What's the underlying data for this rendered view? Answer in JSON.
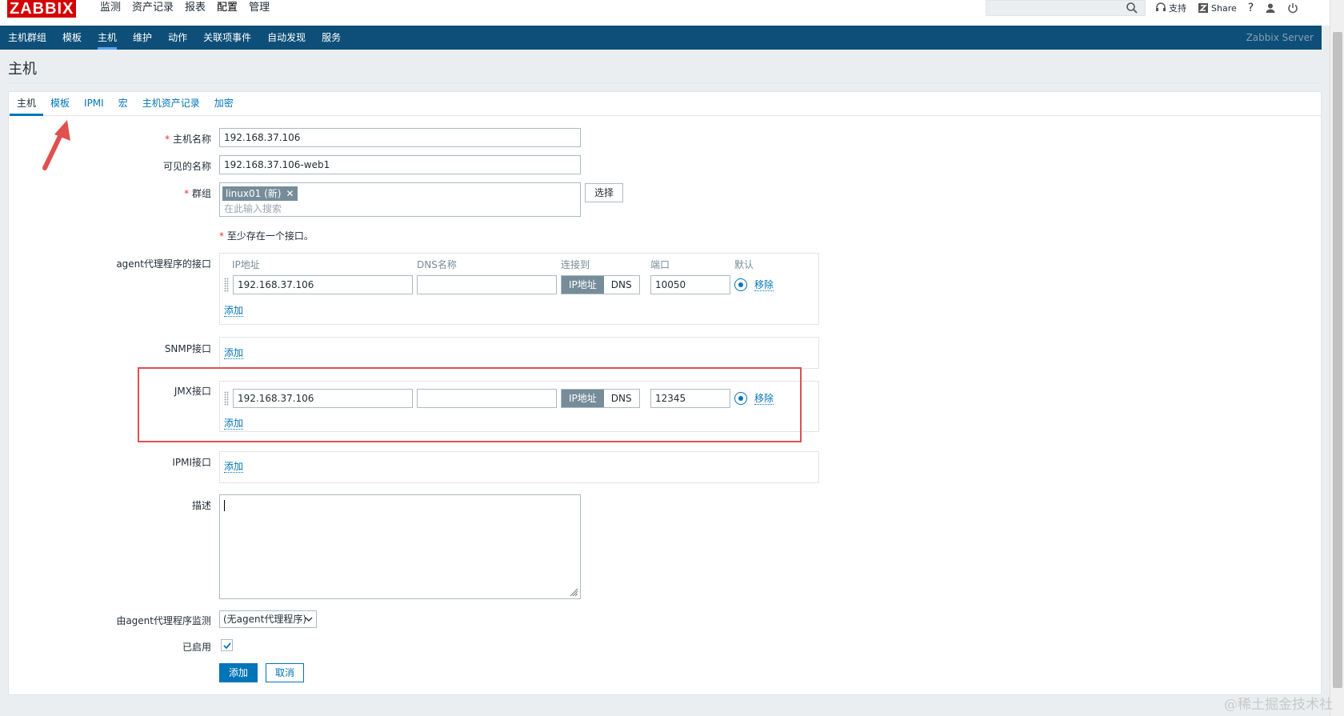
{
  "topbar": {
    "logo": "ZABBIX",
    "menu": [
      "监测",
      "资产记录",
      "报表",
      "配置",
      "管理"
    ],
    "support": "支持",
    "share": "Share",
    "help": "?"
  },
  "subnav": {
    "items": [
      "主机群组",
      "模板",
      "主机",
      "维护",
      "动作",
      "关联项事件",
      "自动发现",
      "服务"
    ],
    "server": "Zabbix Server"
  },
  "page_title": "主机",
  "tabs": [
    "主机",
    "模板",
    "IPMI",
    "宏",
    "主机资产记录",
    "加密"
  ],
  "form": {
    "host_name_label": "主机名称",
    "host_name_value": "192.168.37.106",
    "visible_name_label": "可见的名称",
    "visible_name_value": "192.168.37.106-web1",
    "groups_label": "群组",
    "group_chip": "linux01 (新)",
    "group_placeholder": "在此输入搜索",
    "select_button": "选择",
    "interface_note": "至少存在一个接口。",
    "agent_label": "agent代理程序的接口",
    "col_ip": "IP地址",
    "col_dns": "DNS名称",
    "col_connect": "连接到",
    "col_port": "端口",
    "col_default": "默认",
    "agent_ip": "192.168.37.106",
    "agent_dns": "",
    "agent_port": "10050",
    "seg_ip": "IP地址",
    "seg_dns": "DNS",
    "remove": "移除",
    "add": "添加",
    "snmp_label": "SNMP接口",
    "jmx_label": "JMX接口",
    "jmx_ip": "192.168.37.106",
    "jmx_dns": "",
    "jmx_port": "12345",
    "ipmi_label": "IPMI接口",
    "description_label": "描述",
    "proxy_label": "由agent代理程序监测",
    "proxy_value": "(无agent代理程序)",
    "enabled_label": "已启用",
    "enabled": true,
    "submit": "添加",
    "cancel": "取消"
  },
  "watermark": "@稀土掘金技术社区"
}
